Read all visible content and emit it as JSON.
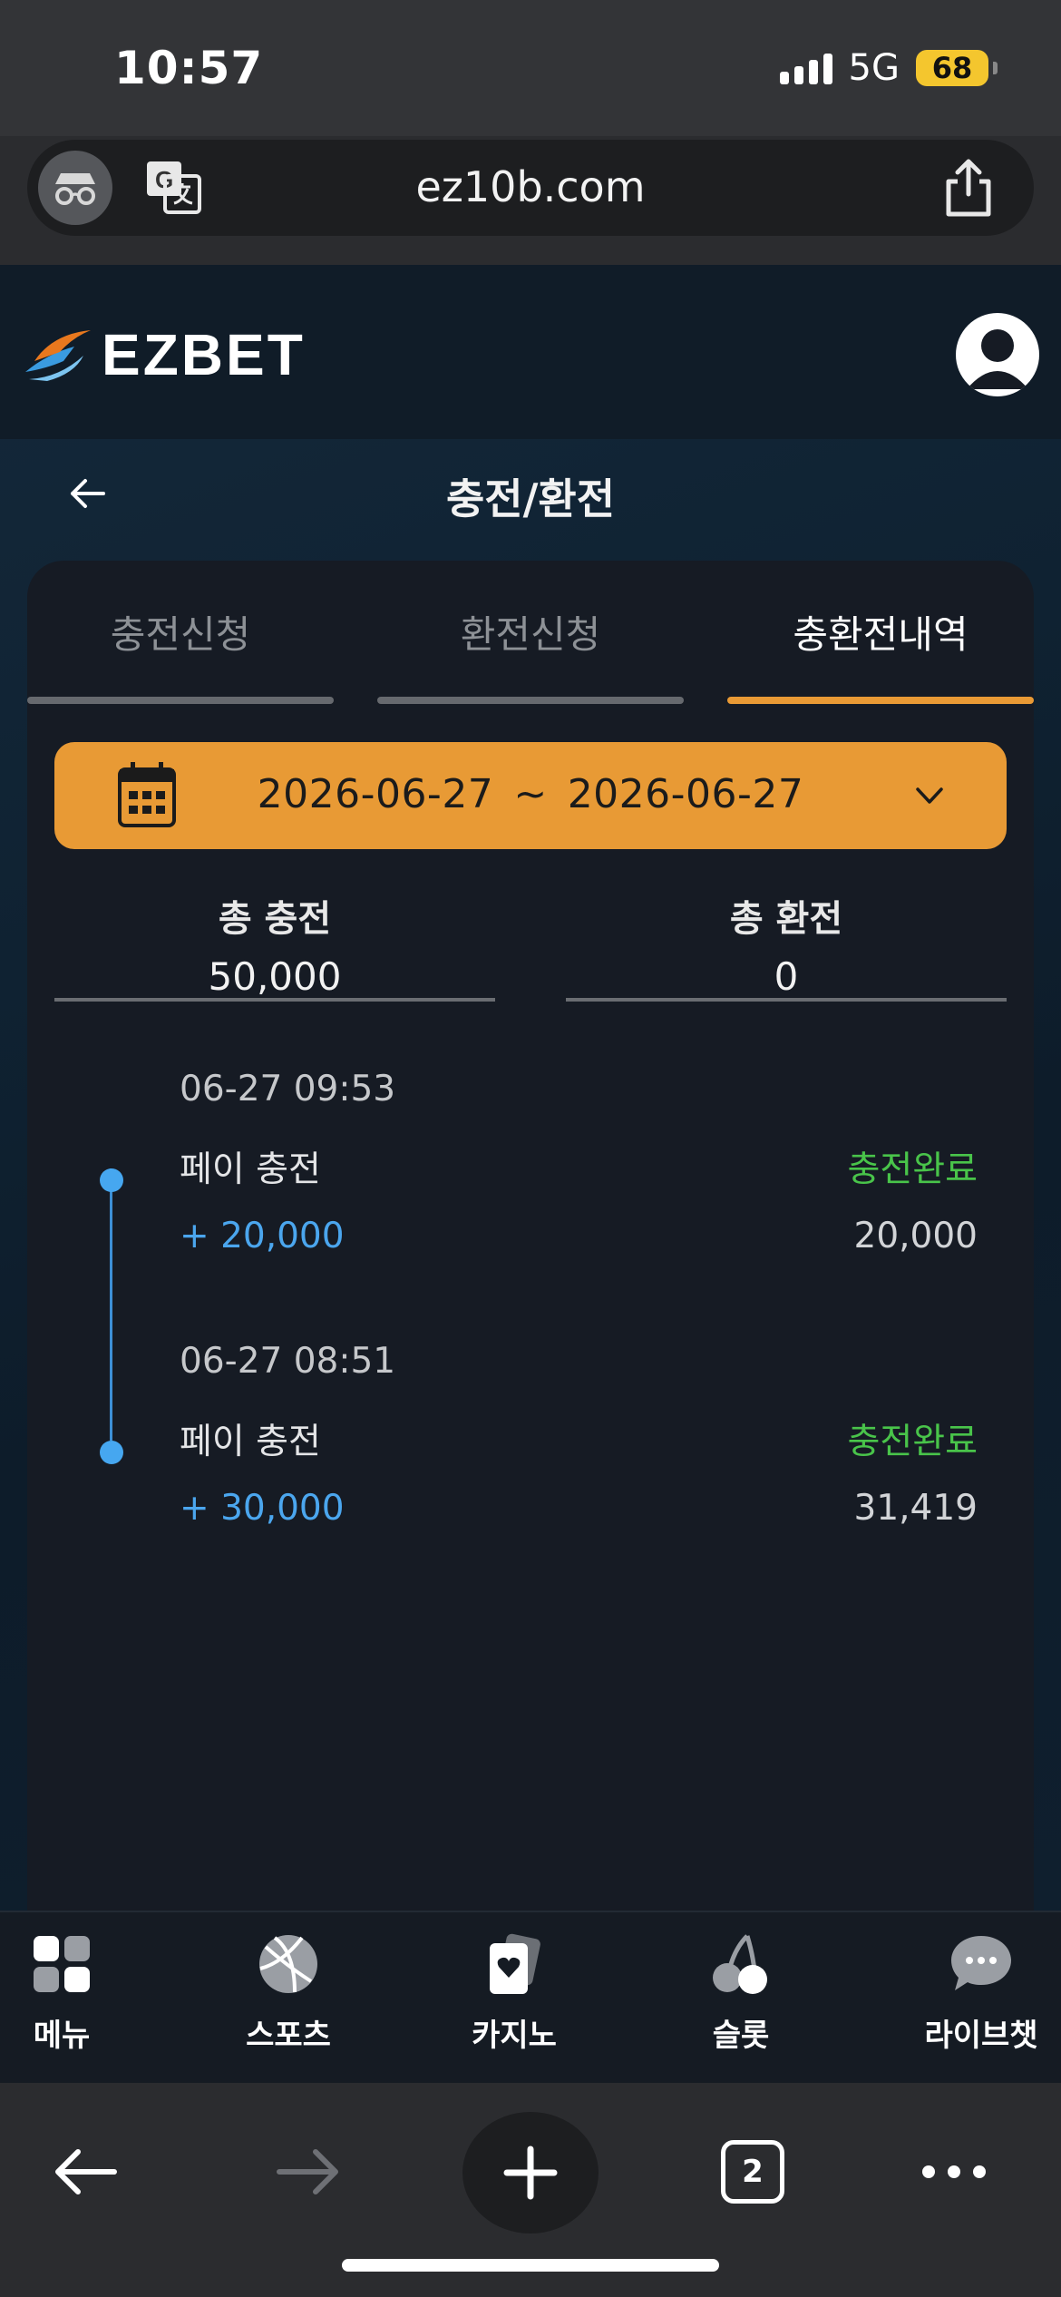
{
  "status_bar": {
    "time": "10:57",
    "network": "5G",
    "battery": "68"
  },
  "browser": {
    "url": "ez10b.com",
    "tab_count": "2"
  },
  "site": {
    "logo_text": "EZBET",
    "page_title": "충전/환전",
    "tabs": [
      {
        "label": "충전신청",
        "active": false
      },
      {
        "label": "환전신청",
        "active": false
      },
      {
        "label": "충환전내역",
        "active": true
      }
    ],
    "date_filter": {
      "start": "2026-06-27",
      "separator": "~",
      "end": "2026-06-27"
    },
    "totals": {
      "deposit_label": "총 충전",
      "deposit_value": "50,000",
      "withdraw_label": "총 환전",
      "withdraw_value": "0"
    },
    "transactions": [
      {
        "time": "06-27 09:53",
        "type": "페이 충전",
        "status": "충전완료",
        "amount": "+ 20,000",
        "balance": "20,000"
      },
      {
        "time": "06-27 08:51",
        "type": "페이 충전",
        "status": "충전완료",
        "amount": "+ 30,000",
        "balance": "31,419"
      }
    ],
    "bottom_nav": [
      {
        "label": "메뉴",
        "icon": "grid-icon"
      },
      {
        "label": "스포츠",
        "icon": "basketball-icon"
      },
      {
        "label": "카지노",
        "icon": "cards-icon"
      },
      {
        "label": "슬롯",
        "icon": "cherry-icon"
      },
      {
        "label": "라이브챗",
        "icon": "chat-icon"
      }
    ]
  },
  "colors": {
    "accent": "#e89a35",
    "status_complete": "#49c44a",
    "amount": "#4ba6ee",
    "panel": "#161b24"
  }
}
